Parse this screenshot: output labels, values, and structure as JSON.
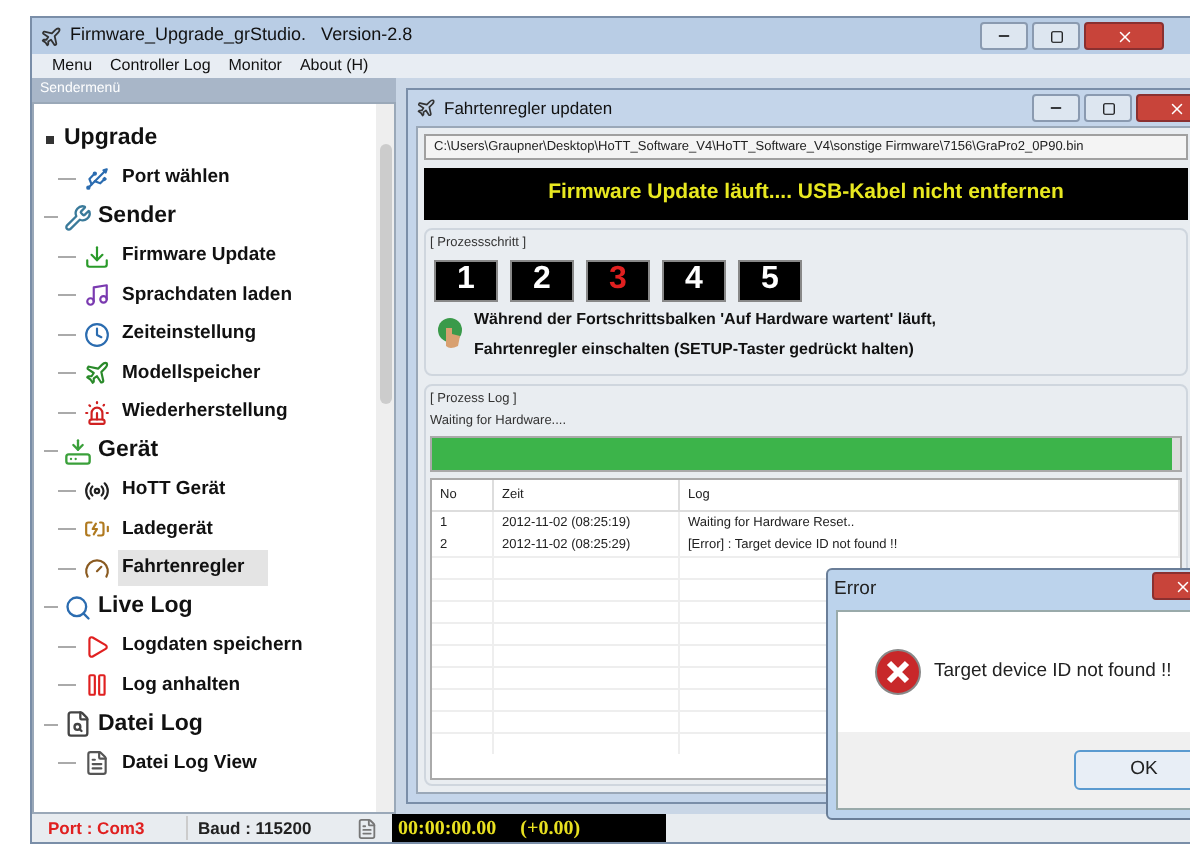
{
  "window": {
    "title": "Firmware_Upgrade_grStudio.   Version-2.8"
  },
  "menu": [
    "Menu",
    "Controller Log",
    "Monitor",
    "About (H)"
  ],
  "sidebar": {
    "title": "Sendermenü",
    "tree": [
      {
        "label": "Upgrade",
        "children": [
          {
            "label": "Port wählen",
            "selected": false
          }
        ]
      },
      {
        "label": "Sender",
        "children": [
          {
            "label": "Firmware Update",
            "selected": false
          },
          {
            "label": "Sprachdaten laden",
            "selected": false
          },
          {
            "label": "Zeiteinstellung",
            "selected": false
          },
          {
            "label": "Modellspeicher",
            "selected": false
          },
          {
            "label": "Wiederherstellung",
            "selected": false
          }
        ]
      },
      {
        "label": "Gerät",
        "children": [
          {
            "label": "HoTT Gerät",
            "selected": false
          },
          {
            "label": "Ladegerät",
            "selected": false
          },
          {
            "label": "Fahrtenregler",
            "selected": true
          }
        ]
      },
      {
        "label": "Live Log",
        "children": [
          {
            "label": "Logdaten speichern",
            "selected": false
          },
          {
            "label": "Log anhalten",
            "selected": false
          }
        ]
      },
      {
        "label": "Datei Log",
        "children": [
          {
            "label": "Datei Log View",
            "selected": false
          }
        ]
      }
    ]
  },
  "child_window": {
    "title": "Fahrtenregler updaten",
    "path": "C:\\Users\\Graupner\\Desktop\\HoTT_Software_V4\\HoTT_Software_V4\\sonstige Firmware\\7156\\GraPro2_0P90.bin",
    "banner": "Firmware Update läuft.... USB-Kabel nicht entfernen",
    "steps_title": "[ Prozessschritt ]",
    "steps": [
      {
        "label": "1",
        "selected": false
      },
      {
        "label": "2",
        "selected": false
      },
      {
        "label": "3",
        "selected": true
      },
      {
        "label": "4",
        "selected": false
      },
      {
        "label": "5",
        "selected": false
      }
    ],
    "instructions": [
      "Während der Fortschrittsbalken 'Auf Hardware wartent' läuft,",
      "Fahrtenregler einschalten (SETUP-Taster gedrückt halten)"
    ],
    "log_title": "[ Prozess Log ]",
    "status": "Waiting for Hardware....",
    "progress": {
      "level": 0.99
    },
    "table": {
      "columns": [
        "No",
        "Zeit",
        "Log"
      ],
      "rows": [
        [
          "1",
          "2012-11-02 (08:25:19)",
          "Waiting for Hardware Reset.."
        ],
        [
          "2",
          "2012-11-02 (08:25:29)",
          "[Error] : Target device ID not found !!"
        ]
      ]
    }
  },
  "status_bar": {
    "port": "Port : Com3",
    "baud": "Baud : 115200",
    "timer": "00:00:00.00",
    "delta": "(+0.00)"
  },
  "dialog": {
    "title": "Error",
    "message": "Target device ID not found !!",
    "button": "OK"
  }
}
